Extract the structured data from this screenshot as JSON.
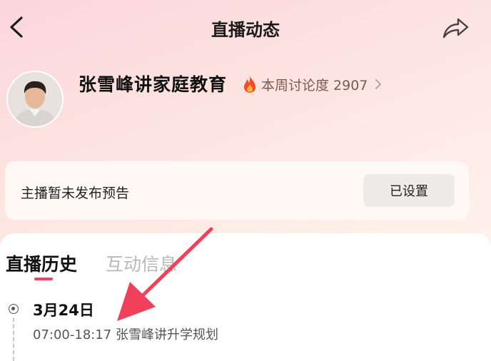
{
  "header": {
    "title": "直播动态",
    "back_icon": "chevron-left-icon",
    "share_icon": "share-icon"
  },
  "anchor": {
    "name": "张雪峰讲家庭教育",
    "heat_label": "本周讨论度 2907",
    "heat_icon": "flame-icon"
  },
  "notice": {
    "label": "主播暂未发布预告",
    "button_label": "已设置"
  },
  "tabs": [
    {
      "label": "直播历史",
      "active": true
    },
    {
      "label": "互动信息",
      "active": false
    }
  ],
  "history": [
    {
      "date": "3月24日",
      "entry": "07:00-18:17 张雪峰讲升学规划"
    }
  ],
  "colors": {
    "accent": "#ff3d5f",
    "annotation_arrow": "#f0405a"
  }
}
